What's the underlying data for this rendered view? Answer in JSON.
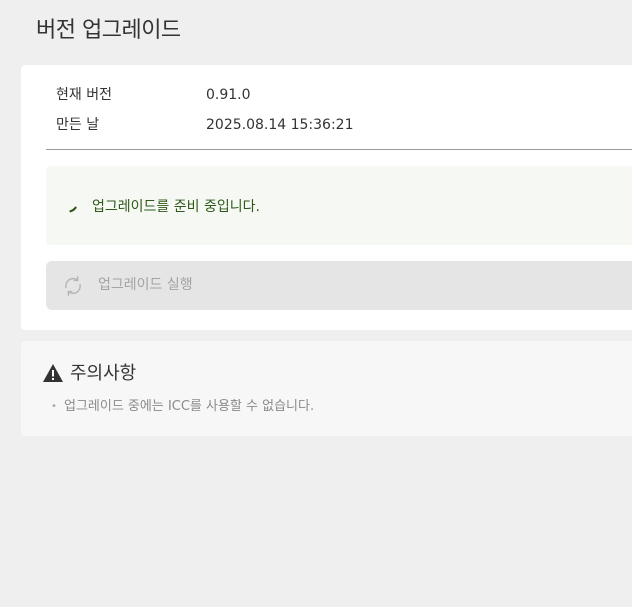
{
  "page": {
    "title": "버전 업그레이드"
  },
  "version_info": {
    "current_version_label": "현재 버전",
    "current_version_value": "0.91.0",
    "build_date_label": "만든 날",
    "build_date_value": "2025.08.14 15:36:21"
  },
  "status": {
    "message": "업그레이드를 준비 중입니다.",
    "color": "#2d5a1b",
    "icon": "loading-spinner-icon"
  },
  "actions": {
    "run_upgrade_label": "업그레이드 실행",
    "run_upgrade_icon": "refresh-icon",
    "run_upgrade_enabled": false
  },
  "caution": {
    "title": "주의사항",
    "icon": "warning-icon",
    "items": [
      "업그레이드 중에는 ICC를 사용할 수 없습니다."
    ]
  }
}
